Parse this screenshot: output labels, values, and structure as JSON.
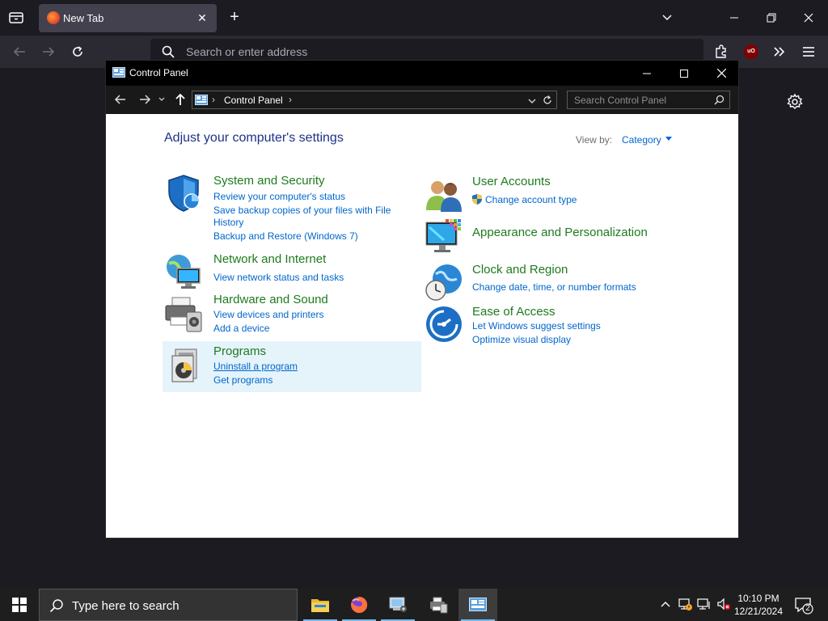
{
  "browser": {
    "tab": {
      "title": "New Tab"
    },
    "urlbar": {
      "placeholder": "Search or enter address"
    }
  },
  "window": {
    "title": "Control Panel",
    "address": {
      "location": "Control Panel"
    },
    "search": {
      "placeholder": "Search Control Panel"
    }
  },
  "content": {
    "heading": "Adjust your computer's settings",
    "view_by": {
      "label": "View by:",
      "value": "Category"
    },
    "categories": [
      {
        "title": "System and Security",
        "icon": "shield-icon",
        "links": [
          "Review your computer's status",
          "Save backup copies of your files with File",
          "History",
          "Backup and Restore (Windows 7)"
        ]
      },
      {
        "title": "Network and Internet",
        "icon": "network-icon",
        "links": [
          "View network status and tasks"
        ]
      },
      {
        "title": "Hardware and Sound",
        "icon": "printer-icon",
        "links": [
          "View devices and printers",
          "Add a device"
        ]
      },
      {
        "title": "Programs",
        "icon": "programs-icon",
        "links": [
          "Uninstall a program",
          "Get programs"
        ]
      },
      {
        "title": "User Accounts",
        "icon": "users-icon",
        "links": [
          "Change account type"
        ]
      },
      {
        "title": "Appearance and Personalization",
        "icon": "monitor-icon",
        "links": []
      },
      {
        "title": "Clock and Region",
        "icon": "clock-globe-icon",
        "links": [
          "Change date, time, or number formats"
        ]
      },
      {
        "title": "Ease of Access",
        "icon": "ease-of-access-icon",
        "links": [
          "Let Windows suggest settings",
          "Optimize visual display"
        ]
      }
    ]
  },
  "taskbar": {
    "search_placeholder": "Type here to search",
    "time": "10:10 PM",
    "date": "12/21/2024",
    "notification_count": "2"
  },
  "colors": {
    "category_title": "#1e7b1e",
    "link": "#0066cc",
    "heading": "#1e3287",
    "hover_highlight": "#e5f3fb"
  }
}
